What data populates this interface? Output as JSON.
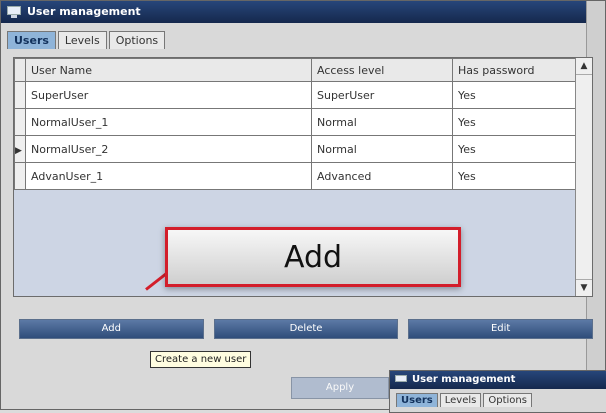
{
  "window": {
    "title": "User management"
  },
  "tabs": [
    {
      "label": "Users",
      "active": true
    },
    {
      "label": "Levels",
      "active": false
    },
    {
      "label": "Options",
      "active": false
    }
  ],
  "table": {
    "headers": [
      "User Name",
      "Access level",
      "Has password"
    ],
    "rows": [
      {
        "user": "SuperUser",
        "access": "SuperUser",
        "password": "Yes",
        "current": false
      },
      {
        "user": "NormalUser_1",
        "access": "Normal",
        "password": "Yes",
        "current": false
      },
      {
        "user": "NormalUser_2",
        "access": "Normal",
        "password": "Yes",
        "current": true
      },
      {
        "user": "AdvanUser_1",
        "access": "Advanced",
        "password": "Yes",
        "current": false
      }
    ]
  },
  "buttons": {
    "add": "Add",
    "delete": "Delete",
    "edit": "Edit",
    "apply": "Apply"
  },
  "tooltip": "Create a new user",
  "callout": "Add",
  "inset": {
    "title": "User management",
    "tabs": [
      "Users",
      "Levels",
      "Options"
    ]
  },
  "colors": {
    "accent": "#d31e2b",
    "titlebar": "#1f3a6b"
  }
}
